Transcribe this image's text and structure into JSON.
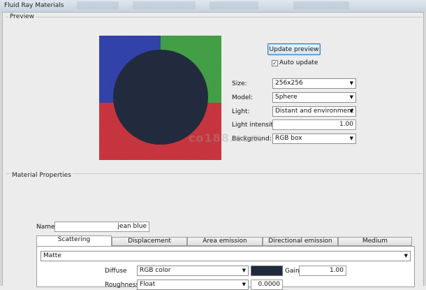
{
  "window": {
    "title": "Fluid Ray Materials"
  },
  "preview": {
    "group_label": "Preview",
    "update_button": "Update preview",
    "auto_update": {
      "label": "Auto update",
      "checked": true
    },
    "size": {
      "label": "Size:",
      "value": "256x256"
    },
    "model": {
      "label": "Model:",
      "value": "Sphere"
    },
    "light": {
      "label": "Light:",
      "value": "Distant and environment"
    },
    "light_intensity": {
      "label": "Light intensity:",
      "value": "1.00"
    },
    "background": {
      "label": "Background:",
      "value": "RGB box"
    }
  },
  "material": {
    "group_label": "Material Properties",
    "name_label": "Name",
    "name_value": "jean blue",
    "tabs": [
      {
        "label": "Scattering",
        "active": true
      },
      {
        "label": "Displacement",
        "active": false
      },
      {
        "label": "Area emission",
        "active": false
      },
      {
        "label": "Directional emission",
        "active": false
      },
      {
        "label": "Medium",
        "active": false
      }
    ],
    "scattering_type": "Matte",
    "diffuse": {
      "label": "Diffuse",
      "type": "RGB color",
      "swatch_color": "#1f2a3c",
      "gain_label": "Gain",
      "gain_value": "1.00"
    },
    "roughness": {
      "label": "Roughness",
      "type": "Float",
      "value": "0.0000"
    }
  },
  "watermark": {
    "text": "co188.com"
  },
  "colors": {
    "sphere": "#222b3d",
    "bg_blue": "#1d2fa8",
    "bg_green": "#2f9a33",
    "bg_red": "#c8202a"
  }
}
